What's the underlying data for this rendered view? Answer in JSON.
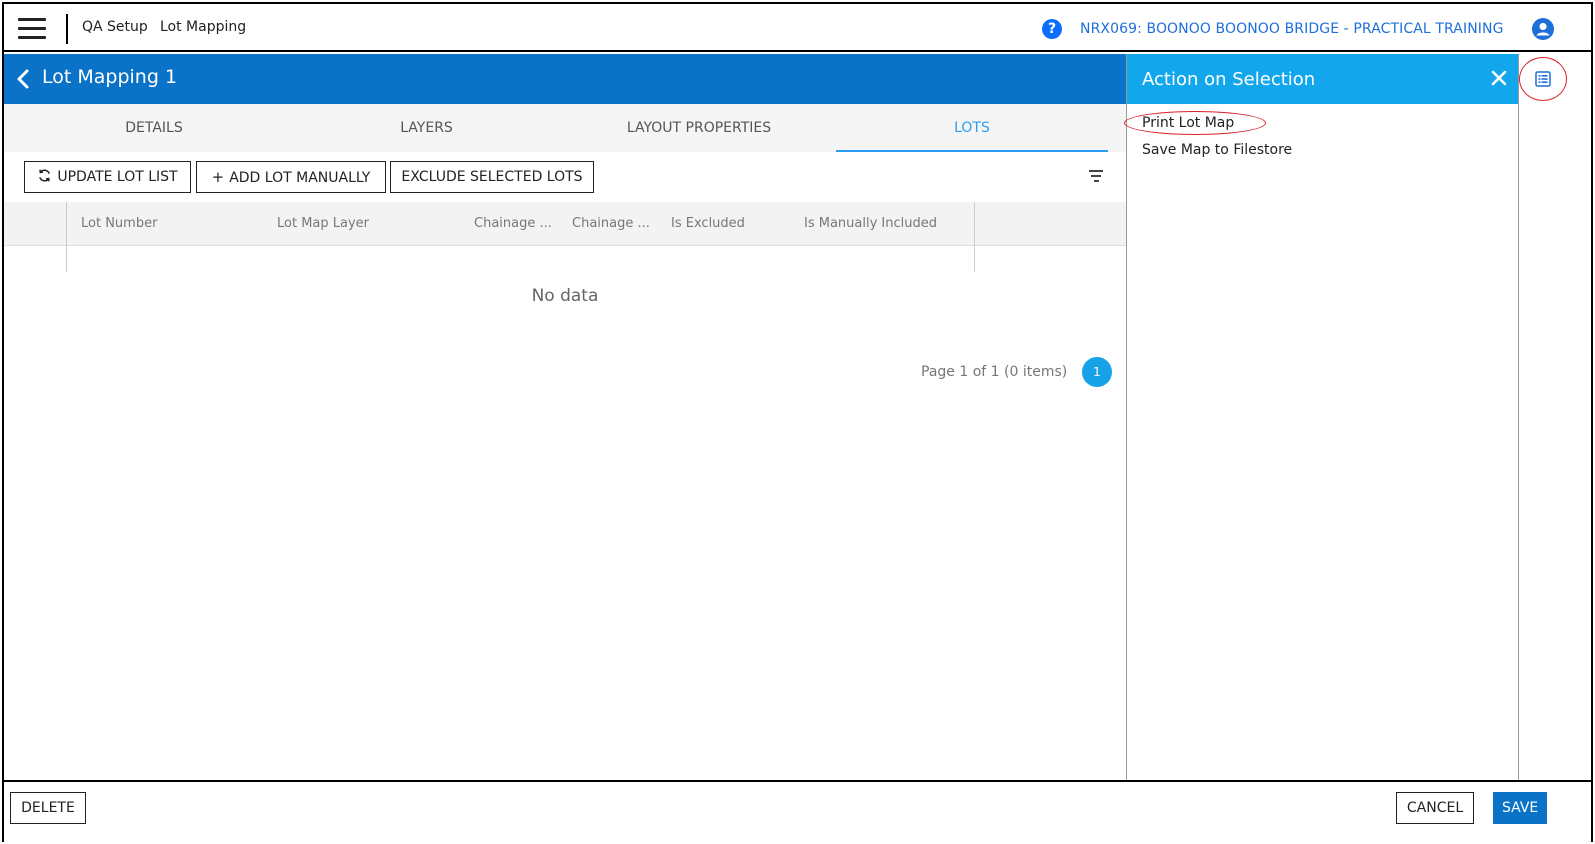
{
  "topbar": {
    "breadcrumb_1": "QA Setup",
    "breadcrumb_2": "Lot Mapping",
    "project": "NRX069: BOONOO BOONOO BRIDGE - PRACTICAL TRAINING"
  },
  "header": {
    "title": "Lot Mapping 1"
  },
  "tabs": [
    {
      "label": "DETAILS",
      "active": false
    },
    {
      "label": "LAYERS",
      "active": false
    },
    {
      "label": "LAYOUT PROPERTIES",
      "active": false
    },
    {
      "label": "LOTS",
      "active": true
    }
  ],
  "toolbar": {
    "update_label": "UPDATE LOT LIST",
    "add_label": "ADD LOT MANUALLY",
    "exclude_label": "EXCLUDE SELECTED LOTS"
  },
  "grid": {
    "columns": [
      "Lot Number",
      "Lot Map Layer",
      "Chainage ...",
      "Chainage ...",
      "Is Excluded",
      "Is Manually Included"
    ],
    "empty_text": "No data",
    "pager_text": "Page 1 of 1 (0 items)",
    "current_page": "1"
  },
  "side_panel": {
    "title": "Action on Selection",
    "actions": [
      "Print Lot Map",
      "Save Map to Filestore"
    ]
  },
  "footer": {
    "delete_label": "DELETE",
    "cancel_label": "CANCEL",
    "save_label": "SAVE"
  },
  "colors": {
    "header_blue": "#0a73c7",
    "panel_blue": "#12a6ec",
    "active_tab": "#2a9df4",
    "link_blue": "#1e6fd9",
    "highlight_red": "#d9202a"
  }
}
